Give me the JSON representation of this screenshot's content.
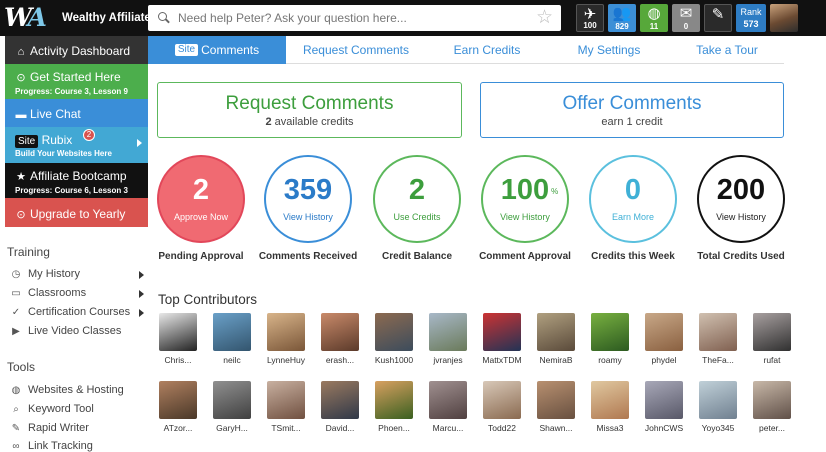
{
  "topbar": {
    "brand_name": "Wealthy Affiliate",
    "search_placeholder": "Need help Peter? Ask your question here...",
    "icons": [
      {
        "name": "plane-icon",
        "badge": "100"
      },
      {
        "name": "people-icon",
        "badge": "829"
      },
      {
        "name": "globe-icon",
        "badge": "11"
      },
      {
        "name": "mail-icon",
        "badge": "0"
      },
      {
        "name": "pen-icon",
        "badge": ""
      }
    ],
    "rank_label": "Rank",
    "rank_value": "573"
  },
  "sidebar": {
    "activity_dashboard": "Activity Dashboard",
    "get_started": {
      "title": "Get Started Here",
      "progress": "Progress: Course 3, Lesson 9"
    },
    "live_chat": "Live Chat",
    "site_rubix": {
      "logo": "Site",
      "name": "Rubix",
      "badge": "2",
      "sub": "Build Your Websites Here"
    },
    "bootcamp": {
      "title": "Affiliate Bootcamp",
      "progress": "Progress: Course 6, Lesson 3"
    },
    "upgrade": "Upgrade to Yearly",
    "training_heading": "Training",
    "training_items": [
      "My History",
      "Classrooms",
      "Certification Courses",
      "Live Video Classes"
    ],
    "tools_heading": "Tools",
    "tools_items": [
      "Websites & Hosting",
      "Keyword Tool",
      "Rapid Writer",
      "Link Tracking"
    ]
  },
  "tabs": {
    "site_chip": "Site",
    "comments": "Comments",
    "request_comments": "Request Comments",
    "earn_credits": "Earn Credits",
    "my_settings": "My Settings",
    "take_tour": "Take a Tour"
  },
  "actions": {
    "request": {
      "title": "Request Comments",
      "count": "2",
      "sub": "available credits"
    },
    "offer": {
      "title": "Offer Comments",
      "sub": "earn 1 credit"
    }
  },
  "stats": [
    {
      "value": "2",
      "caption": "Approve Now",
      "label": "Pending Approval"
    },
    {
      "value": "359",
      "caption": "View History",
      "label": "Comments Received"
    },
    {
      "value": "2",
      "caption": "Use Credits",
      "label": "Credit Balance"
    },
    {
      "value": "100",
      "suffix": "%",
      "caption": "View History",
      "label": "Comment Approval"
    },
    {
      "value": "0",
      "caption": "Earn More",
      "label": "Credits this Week"
    },
    {
      "value": "200",
      "caption": "View History",
      "label": "Total Credits Used"
    }
  ],
  "contributors_title": "Top Contributors",
  "contributors_row1": [
    "Chris...",
    "neilc",
    "LynneHuy",
    "erash...",
    "Kush1000",
    "jvranjes",
    "MattxTDM",
    "NemiraB",
    "roamy",
    "phydel",
    "TheFa...",
    "rufat"
  ],
  "contributors_row2": [
    "ATzor...",
    "GaryH...",
    "TSmit...",
    "David...",
    "Phoen...",
    "Marcu...",
    "Todd22",
    "Shawn...",
    "Missa3",
    "JohnCWS",
    "Yoyo345",
    "peter..."
  ]
}
